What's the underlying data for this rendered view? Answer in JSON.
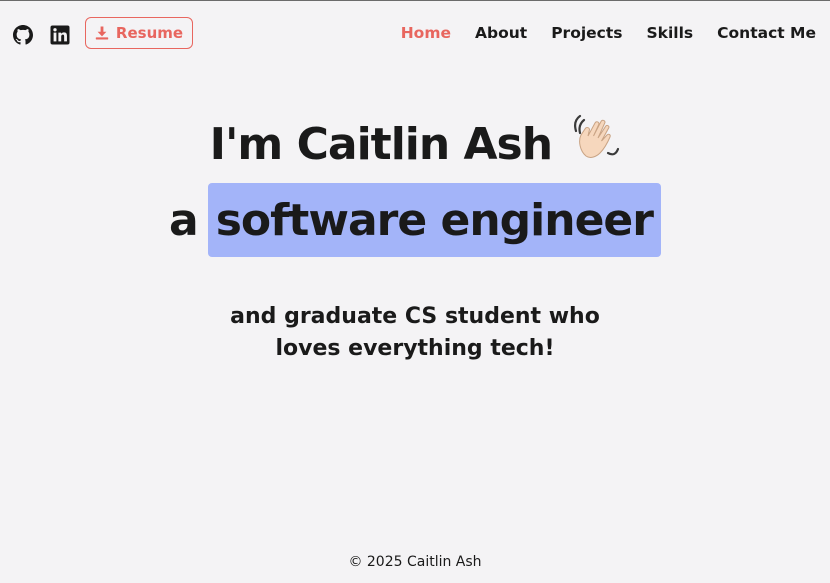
{
  "header": {
    "social": [
      {
        "icon": "github-icon"
      },
      {
        "icon": "linkedin-icon"
      }
    ],
    "resume_label": "Resume",
    "nav": [
      {
        "label": "Home",
        "active": true
      },
      {
        "label": "About",
        "active": false
      },
      {
        "label": "Projects",
        "active": false
      },
      {
        "label": "Skills",
        "active": false
      },
      {
        "label": "Contact Me",
        "active": false
      }
    ]
  },
  "hero": {
    "greeting": "I'm Caitlin Ash",
    "wave_icon": "waving-hand-icon",
    "prefix": "a",
    "role": "software engineer",
    "tagline_line1": "and graduate CS student who",
    "tagline_line2": "loves everything tech!"
  },
  "footer": {
    "copyright": "© 2025 Caitlin Ash"
  },
  "colors": {
    "accent": "#e8665f",
    "highlight": "#a3b4f9",
    "background": "#f4f3f5",
    "text": "#1a1a1a"
  }
}
